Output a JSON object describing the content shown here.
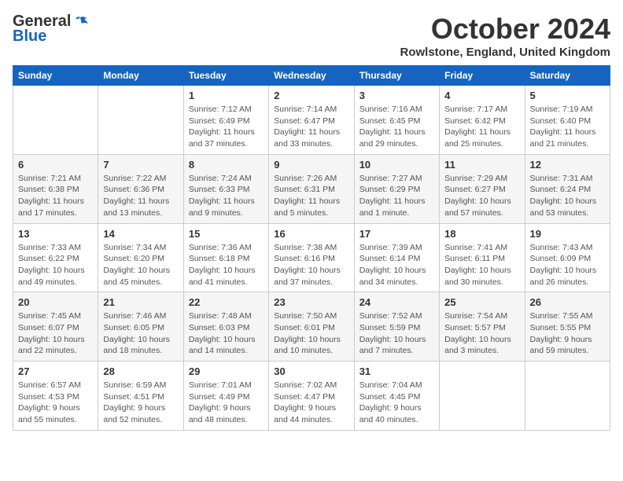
{
  "header": {
    "logo_line1": "General",
    "logo_line2": "Blue",
    "month": "October 2024",
    "location": "Rowlstone, England, United Kingdom"
  },
  "weekdays": [
    "Sunday",
    "Monday",
    "Tuesday",
    "Wednesday",
    "Thursday",
    "Friday",
    "Saturday"
  ],
  "weeks": [
    [
      {
        "day": "",
        "info": ""
      },
      {
        "day": "",
        "info": ""
      },
      {
        "day": "1",
        "info": "Sunrise: 7:12 AM\nSunset: 6:49 PM\nDaylight: 11 hours and 37 minutes."
      },
      {
        "day": "2",
        "info": "Sunrise: 7:14 AM\nSunset: 6:47 PM\nDaylight: 11 hours and 33 minutes."
      },
      {
        "day": "3",
        "info": "Sunrise: 7:16 AM\nSunset: 6:45 PM\nDaylight: 11 hours and 29 minutes."
      },
      {
        "day": "4",
        "info": "Sunrise: 7:17 AM\nSunset: 6:42 PM\nDaylight: 11 hours and 25 minutes."
      },
      {
        "day": "5",
        "info": "Sunrise: 7:19 AM\nSunset: 6:40 PM\nDaylight: 11 hours and 21 minutes."
      }
    ],
    [
      {
        "day": "6",
        "info": "Sunrise: 7:21 AM\nSunset: 6:38 PM\nDaylight: 11 hours and 17 minutes."
      },
      {
        "day": "7",
        "info": "Sunrise: 7:22 AM\nSunset: 6:36 PM\nDaylight: 11 hours and 13 minutes."
      },
      {
        "day": "8",
        "info": "Sunrise: 7:24 AM\nSunset: 6:33 PM\nDaylight: 11 hours and 9 minutes."
      },
      {
        "day": "9",
        "info": "Sunrise: 7:26 AM\nSunset: 6:31 PM\nDaylight: 11 hours and 5 minutes."
      },
      {
        "day": "10",
        "info": "Sunrise: 7:27 AM\nSunset: 6:29 PM\nDaylight: 11 hours and 1 minute."
      },
      {
        "day": "11",
        "info": "Sunrise: 7:29 AM\nSunset: 6:27 PM\nDaylight: 10 hours and 57 minutes."
      },
      {
        "day": "12",
        "info": "Sunrise: 7:31 AM\nSunset: 6:24 PM\nDaylight: 10 hours and 53 minutes."
      }
    ],
    [
      {
        "day": "13",
        "info": "Sunrise: 7:33 AM\nSunset: 6:22 PM\nDaylight: 10 hours and 49 minutes."
      },
      {
        "day": "14",
        "info": "Sunrise: 7:34 AM\nSunset: 6:20 PM\nDaylight: 10 hours and 45 minutes."
      },
      {
        "day": "15",
        "info": "Sunrise: 7:36 AM\nSunset: 6:18 PM\nDaylight: 10 hours and 41 minutes."
      },
      {
        "day": "16",
        "info": "Sunrise: 7:38 AM\nSunset: 6:16 PM\nDaylight: 10 hours and 37 minutes."
      },
      {
        "day": "17",
        "info": "Sunrise: 7:39 AM\nSunset: 6:14 PM\nDaylight: 10 hours and 34 minutes."
      },
      {
        "day": "18",
        "info": "Sunrise: 7:41 AM\nSunset: 6:11 PM\nDaylight: 10 hours and 30 minutes."
      },
      {
        "day": "19",
        "info": "Sunrise: 7:43 AM\nSunset: 6:09 PM\nDaylight: 10 hours and 26 minutes."
      }
    ],
    [
      {
        "day": "20",
        "info": "Sunrise: 7:45 AM\nSunset: 6:07 PM\nDaylight: 10 hours and 22 minutes."
      },
      {
        "day": "21",
        "info": "Sunrise: 7:46 AM\nSunset: 6:05 PM\nDaylight: 10 hours and 18 minutes."
      },
      {
        "day": "22",
        "info": "Sunrise: 7:48 AM\nSunset: 6:03 PM\nDaylight: 10 hours and 14 minutes."
      },
      {
        "day": "23",
        "info": "Sunrise: 7:50 AM\nSunset: 6:01 PM\nDaylight: 10 hours and 10 minutes."
      },
      {
        "day": "24",
        "info": "Sunrise: 7:52 AM\nSunset: 5:59 PM\nDaylight: 10 hours and 7 minutes."
      },
      {
        "day": "25",
        "info": "Sunrise: 7:54 AM\nSunset: 5:57 PM\nDaylight: 10 hours and 3 minutes."
      },
      {
        "day": "26",
        "info": "Sunrise: 7:55 AM\nSunset: 5:55 PM\nDaylight: 9 hours and 59 minutes."
      }
    ],
    [
      {
        "day": "27",
        "info": "Sunrise: 6:57 AM\nSunset: 4:53 PM\nDaylight: 9 hours and 55 minutes."
      },
      {
        "day": "28",
        "info": "Sunrise: 6:59 AM\nSunset: 4:51 PM\nDaylight: 9 hours and 52 minutes."
      },
      {
        "day": "29",
        "info": "Sunrise: 7:01 AM\nSunset: 4:49 PM\nDaylight: 9 hours and 48 minutes."
      },
      {
        "day": "30",
        "info": "Sunrise: 7:02 AM\nSunset: 4:47 PM\nDaylight: 9 hours and 44 minutes."
      },
      {
        "day": "31",
        "info": "Sunrise: 7:04 AM\nSunset: 4:45 PM\nDaylight: 9 hours and 40 minutes."
      },
      {
        "day": "",
        "info": ""
      },
      {
        "day": "",
        "info": ""
      }
    ]
  ]
}
